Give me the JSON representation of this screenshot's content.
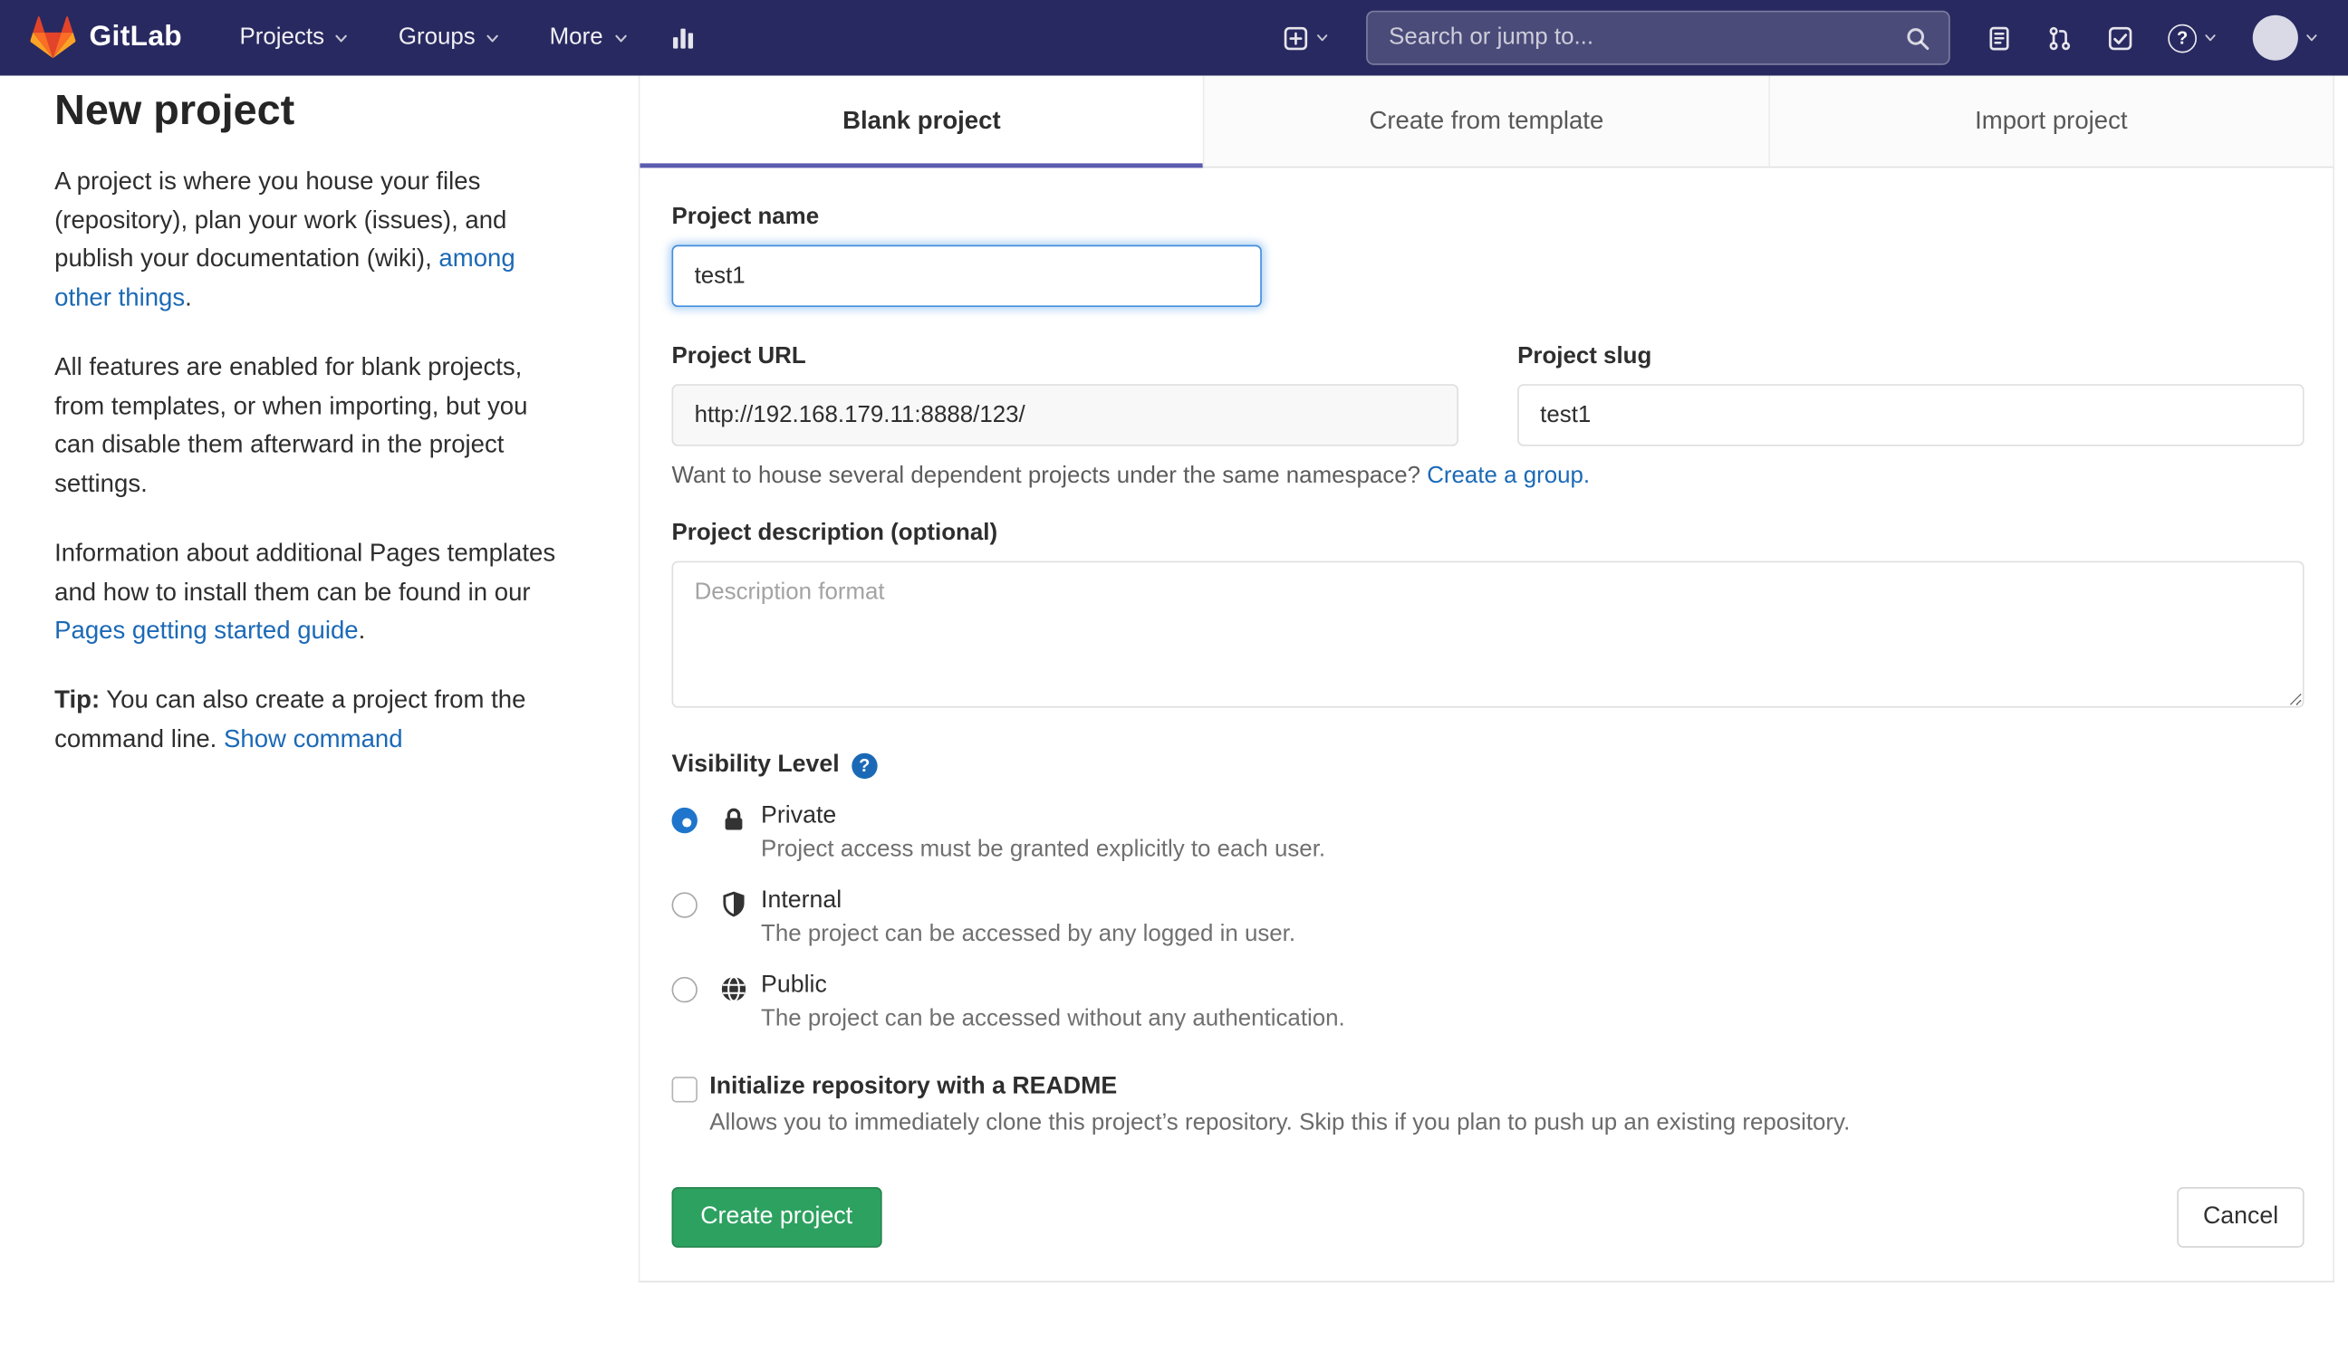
{
  "navbar": {
    "brand": "GitLab",
    "nav_items": [
      {
        "label": "Projects"
      },
      {
        "label": "Groups"
      },
      {
        "label": "More"
      }
    ],
    "search_placeholder": "Search or jump to..."
  },
  "icons": {
    "question_glyph": "?"
  },
  "intro": {
    "title": "New project",
    "p1_text": "A project is where you house your files (repository), plan your work (issues), and publish your documentation (wiki), ",
    "p1_link": "among other things",
    "p1_end": ".",
    "p2": "All features are enabled for blank projects, from templates, or when importing, but you can disable them afterward in the project settings.",
    "p3_text": "Information about additional Pages templates and how to install them can be found in our ",
    "p3_link": "Pages getting started guide",
    "p3_end": ".",
    "tip_label": "Tip:",
    "tip_text": " You can also create a project from the command line. ",
    "tip_link": "Show command"
  },
  "tabs": [
    {
      "label": "Blank project",
      "active": true
    },
    {
      "label": "Create from template",
      "active": false
    },
    {
      "label": "Import project",
      "active": false
    }
  ],
  "form": {
    "project_name_label": "Project name",
    "project_name_value": "test1",
    "project_url_label": "Project URL",
    "project_url_value": "http://192.168.179.11:8888/123/",
    "project_slug_label": "Project slug",
    "project_slug_value": "test1",
    "namespace_hint_text": "Want to house several dependent projects under the same namespace? ",
    "namespace_hint_link": "Create a group.",
    "description_label": "Project description (optional)",
    "description_placeholder": "Description format",
    "visibility_label": "Visibility Level",
    "visibility_options": [
      {
        "name": "Private",
        "description": "Project access must be granted explicitly to each user.",
        "selected": true
      },
      {
        "name": "Internal",
        "description": "The project can be accessed by any logged in user.",
        "selected": false
      },
      {
        "name": "Public",
        "description": "The project can be accessed without any authentication.",
        "selected": false
      }
    ],
    "readme_label": "Initialize repository with a README",
    "readme_description": "Allows you to immediately clone this project’s repository. Skip this if you plan to push up an existing repository.",
    "submit_label": "Create project",
    "cancel_label": "Cancel"
  },
  "colors": {
    "navbar_bg": "#292961",
    "link": "#1b69b6",
    "primary_green": "#2da160",
    "tab_indicator": "#5b5bb0",
    "radio_selected": "#1f75cb"
  }
}
